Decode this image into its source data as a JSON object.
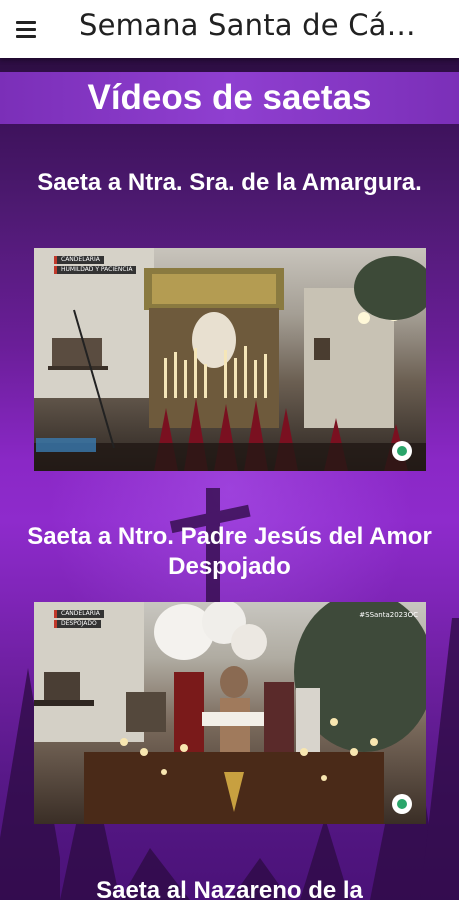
{
  "appbar": {
    "menu_icon": "hamburger-menu-icon",
    "title": "Semana Santa de Cá…"
  },
  "page": {
    "banner_title": "Vídeos de saetas",
    "colors": {
      "banner": "#8a3cc9",
      "background_top": "#2b0d40",
      "background_mid": "#8e2bcc"
    }
  },
  "videos": [
    {
      "title": "Saeta a Ntra. Sra. de la Amargura.",
      "thumbnail_label_1": "CANDELARIA",
      "thumbnail_label_2": "HUMILDAD Y PACIENCIA",
      "thumbnail_tag": "",
      "channel_logo": "onda-cadiz-logo"
    },
    {
      "title": "Saeta a Ntro. Padre Jesús del Amor Despojado",
      "thumbnail_label_1": "CANDELARIA",
      "thumbnail_label_2": "DESPOJADO",
      "thumbnail_tag": "#SSanta2023OC",
      "channel_logo": "onda-cadiz-logo"
    },
    {
      "title": "Saeta al Nazareno de la"
    }
  ]
}
